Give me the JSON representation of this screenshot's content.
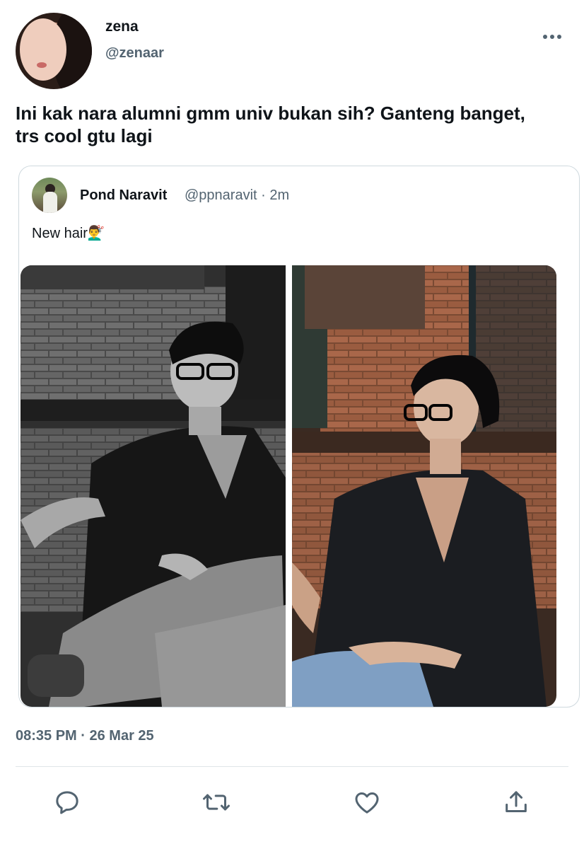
{
  "author": {
    "name": "zena",
    "handle": "@zenaar"
  },
  "tweet": {
    "text": "Ini kak nara alumni gmm univ bukan sih? Ganteng banget, trs cool gtu lagi"
  },
  "quoted": {
    "name": "Pond Naravit",
    "meta": "@ppnaravit · 2m",
    "text": "New hair💇‍♂️"
  },
  "timestamp": "08:35 PM · 26 Mar 25",
  "icons": {
    "more": "more-horizontal-icon",
    "reply": "reply-icon",
    "retweet": "retweet-icon",
    "like": "heart-icon",
    "share": "share-icon"
  },
  "colors": {
    "text": "#0f1419",
    "secondary": "#536471",
    "border": "#cfd9de"
  }
}
